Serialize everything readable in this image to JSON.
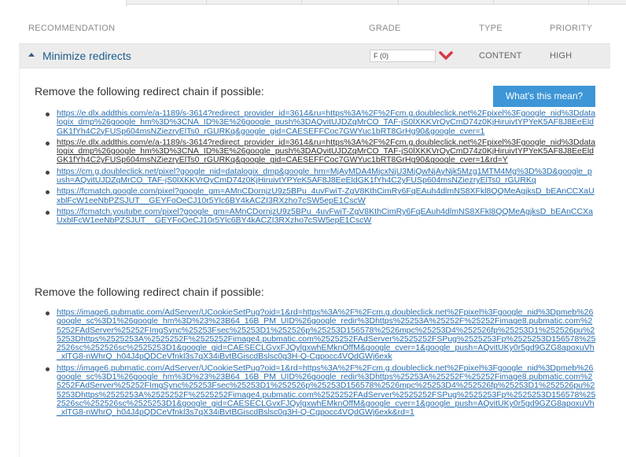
{
  "columns": {
    "recommendation": "RECOMMENDATION",
    "grade": "GRADE",
    "type": "TYPE",
    "priority": "PRIORITY"
  },
  "recommendation_row": {
    "title": "Minimize redirects",
    "grade": "F (0)",
    "type": "CONTENT",
    "priority": "HIGH"
  },
  "whats_this_label": "What's this mean?",
  "section1": {
    "heading": "Remove the following redirect chain if possible:",
    "links": [
      "https://e.dlx.addthis.com/e/a-1189/s-3614?redirect_provider_id=3614&ru=https%3A%2F%2Fcm.g.doubleclick.net%2Fpixel%3Fgoogle_nid%3Ddatalogix_dmp%26google_hm%3D%3CNA_ID%3E%26google_push%3DAQvitUJDZqMrCO_TAF-jS0lXKKVrOyCmD74z0KjHiruivtYPYeK5AF8J8EeEldGK1fYh4C2yFUSp604msNZiezryElTs0_rGURKq&google_gid=CAESEFFCoc7GWYuc1bRT8GrHg90&google_cver=1",
      "https://e.dlx.addthis.com/e/a-1189/s-3614?redirect_provider_id=3614&ru=https%3A%2F%2Fcm.g.doubleclick.net%2Fpixel%3Fgoogle_nid%3Ddatalogix_dmp%26google_hm%3D%3CNA_ID%3E%26google_push%3DAQvitUJDZqMrCO_TAF-jS0lXKKVrOyCmD74z0KjHiruivtYPYeK5AF8J8EeEldGK1fYh4C2yFUSp604msNZiezryElTs0_rGURKq&google_gid=CAESEFFCoc7GWYuc1bRT8GrHg90&google_cver=1&rd=Y",
      "https://cm.g.doubleclick.net/pixel?google_nid=datalogix_dmp&google_hm=MjAyMDA4MjcxNjU3MjQwNjAyNjk5Mzg1MTM4Mg%3D%3D&google_push=AQvitUJDZqMrCO_TAF-jS0lXKKVrOyCmD74z0KjHiruivtYPYeK5AF8J8EeEldGK1fYh4C2yFUSp604msNZiezryElTs0_rGURKq",
      "https://fcmatch.google.com/pixel?google_gm=AMnCDornjzU9z5BPu_4uvFwiT-ZgV8KthCimRy6FqEAuh4dlmNS8XFkl8QQMeAgjksD_bEAnCCXaUxblFcW1eeNbPZSJUT__GEYFoOeCJ10r5Ylc6BY4kACZI3RXzho7cSW5epE1CscW",
      "https://fcmatch.youtube.com/pixel?google_gm=AMnCDornjzU9z5BPu_4uvFwiT-ZgV8KthCimRy6FqEAuh4dlmNS8XFkl8QQMeAgjksD_bEAnCCXaUxblFcW1eeNbPZSJUT__GEYFoOeCJ10r5Ylc6BY4kACZI3RXzho7cSW5epE1CscW"
    ]
  },
  "section2": {
    "heading": "Remove the following redirect chain if possible:",
    "links": [
      "https://image6.pubmatic.com/AdServer/UCookieSetPug?oid=1&rd=https%3A%2F%2Fcm.g.doubleclick.net%2Fpixel%3Fgoogle_nid%3Dpmeb%26google_sc%3D1%26google_hm%3D%23%23B64_16B_PM_UID%26google_redir%3Dhttps%25253A%25252F%25252Fimage8.pubmatic.com%25252FAdServer%25252FImgSync%25253Fsec%25253D1%252526p%25253D156578%2526mpc%25253D4%252526fp%25253D1%252526pu%25253Dhttps%2525253A%2525252F%2525252Fimage4.pubmatic.com%2525252FAdServer%2525252FSPug%2525253Fp%2525253D156578%252526sc%252526sc%2525253D1&google_gid=CAESECLGvxFJQylgxwhEMknOffM&google_cver=1&google_push=AQvitUKy0r5gd9GZG8apoxuVh_xlTG8-nWhrQ_h04J4pQDCeVfnkl3s7qX34iBvtBGiscdBslsc0g3H-Q-Cgpocc4VQdGWj6exk",
      "https://image6.pubmatic.com/AdServer/UCookieSetPug?oid=1&rd=https%3A%2F%2Fcm.g.doubleclick.net%2Fpixel%3Fgoogle_nid%3Dpmeb%26google_sc%3D1%26google_hm%3D%23%23B64_16B_PM_UID%26google_redir%3Dhttps%25253A%25252F%25252Fimage8.pubmatic.com%25252FAdServer%25252FImgSync%25253Fsec%25253D1%252526p%25253D156578%2526mpc%25253D4%252526fp%25253D1%252526pu%25253Dhttps%2525253A%2525252F%2525252Fimage4.pubmatic.com%2525252FAdServer%2525252FSPug%2525253Fp%2525253D156578%252526sc%252526sc%2525253D1&google_gid=CAESECLGvxFJQylgxwhEMknOffM&google_cver=1&google_push=AQvitUKy0r5gd9GZG8apoxuVh_xlTG8-nWhrQ_h04J4pQDCeVfnkl3s7qX34iBvtBGiscdBslsc0g3H-Q-Cgpocc4VQdGWj6exk&rd=1"
    ]
  },
  "colors": {
    "link": "#2a6fb0",
    "button": "#3e96d6",
    "title": "#1e5b8a",
    "grade_chevron": "#d9364b",
    "row_bg": "#ececec"
  }
}
